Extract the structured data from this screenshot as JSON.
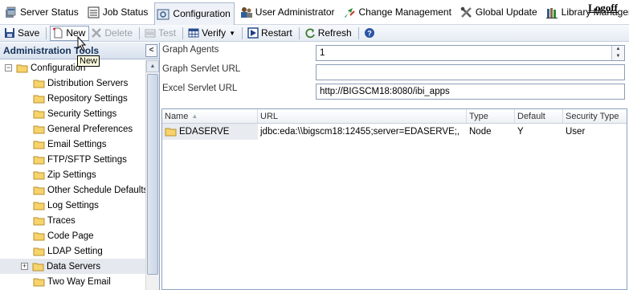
{
  "topnav": {
    "tabs": [
      {
        "label": "Server Status",
        "icon": "server-status-icon"
      },
      {
        "label": "Job Status",
        "icon": "job-status-icon"
      },
      {
        "label": "Configuration",
        "icon": "configuration-icon",
        "active": true
      },
      {
        "label": "User Administrator",
        "icon": "users-icon"
      },
      {
        "label": "Change Management",
        "icon": "change-management-icon"
      },
      {
        "label": "Global Update",
        "icon": "tools-icon"
      },
      {
        "label": "Library Manager",
        "icon": "library-icon"
      }
    ],
    "logoff": "Logoff"
  },
  "toolbar": {
    "save": "Save",
    "new": "New",
    "delete": "Delete",
    "test": "Test",
    "verify": "Verify",
    "restart": "Restart",
    "refresh": "Refresh"
  },
  "tooltip": "New",
  "left_panel": {
    "title": "Administration Tools",
    "collapse_glyph": "<",
    "tree": {
      "root": "Configuration",
      "items": [
        "Distribution Servers",
        "Repository Settings",
        "Security Settings",
        "General Preferences",
        "Email Settings",
        "FTP/SFTP Settings",
        "Zip Settings",
        "Other Schedule Defaults",
        "Log Settings",
        "Traces",
        "Code Page",
        "LDAP Setting",
        "Data Servers",
        "Two Way Email"
      ],
      "selected": "Data Servers"
    }
  },
  "form": {
    "graph_agents_label": "Graph Agents",
    "graph_agents_value": "1",
    "graph_servlet_label": "Graph Servlet URL",
    "graph_servlet_value": "",
    "excel_servlet_label": "Excel Servlet URL",
    "excel_servlet_value": "http://BIGSCM18:8080/ibi_apps"
  },
  "grid": {
    "columns": [
      "Name",
      "URL",
      "Type",
      "Default",
      "Security Type"
    ],
    "rows": [
      {
        "name": "EDASERVE",
        "url": "jdbc:eda:\\\\bigscm18:12455;server=EDASERVE;,",
        "type": "Node",
        "default": "Y",
        "security_type": "User"
      }
    ]
  },
  "colors": {
    "accent": "#15325b",
    "folder": "#f2c94c",
    "border": "#8da2c0"
  }
}
